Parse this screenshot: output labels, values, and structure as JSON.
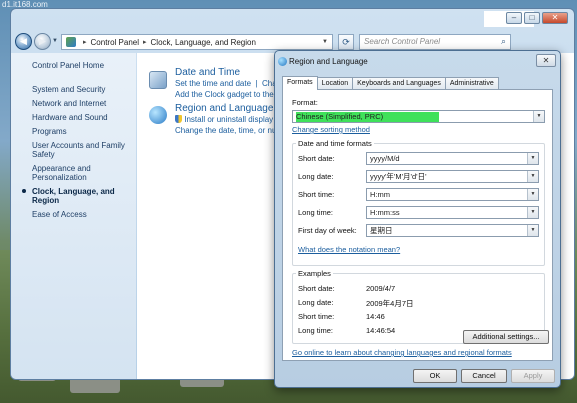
{
  "watermark": "d1.it168.com",
  "control_panel": {
    "window_buttons": {
      "minimize": "–",
      "maximize": "□",
      "close": "✕"
    },
    "address": {
      "crumbs": [
        "Control Panel",
        "Clock, Language, and Region"
      ],
      "search_placeholder": "Search Control Panel"
    },
    "sidebar": {
      "home": "Control Panel Home",
      "items": [
        "System and Security",
        "Network and Internet",
        "Hardware and Sound",
        "Programs",
        "User Accounts and Family Safety",
        "Appearance and Personalization",
        "Clock, Language, and Region",
        "Ease of Access"
      ],
      "active_index": 6
    },
    "categories": [
      {
        "title": "Date and Time",
        "links": [
          "Set the time and date",
          "Change",
          "Add the Clock gadget to the deskt"
        ]
      },
      {
        "title": "Region and Language",
        "links": [
          "Install or uninstall display lang",
          "Change the date, time, or numb"
        ]
      }
    ]
  },
  "dialog": {
    "title": "Region and Language",
    "close_glyph": "✕",
    "tabs": [
      "Formats",
      "Location",
      "Keyboards and Languages",
      "Administrative"
    ],
    "active_tab": 0,
    "format_label": "Format:",
    "format_value": "Chinese (Simplified, PRC)",
    "change_sorting": "Change sorting method",
    "formats_group_title": "Date and time formats",
    "fields": [
      {
        "label": "Short date:",
        "value": "yyyy/M/d"
      },
      {
        "label": "Long date:",
        "value": "yyyy'年'M'月'd'日'"
      },
      {
        "label": "Short time:",
        "value": "H:mm"
      },
      {
        "label": "Long time:",
        "value": "H:mm:ss"
      },
      {
        "label": "First day of week:",
        "value": "星期日"
      }
    ],
    "notation_link": "What does the notation mean?",
    "examples_title": "Examples",
    "examples": [
      {
        "label": "Short date:",
        "value": "2009/4/7"
      },
      {
        "label": "Long date:",
        "value": "2009年4月7日"
      },
      {
        "label": "Short time:",
        "value": "14:46"
      },
      {
        "label": "Long time:",
        "value": "14:46:54"
      }
    ],
    "additional_settings": "Additional settings...",
    "online_link": "Go online to learn about changing languages and regional formats",
    "buttons": {
      "ok": "OK",
      "cancel": "Cancel",
      "apply": "Apply"
    }
  },
  "colors": {
    "format_highlight": "#3fe15a",
    "link": "#1c5e9e"
  }
}
